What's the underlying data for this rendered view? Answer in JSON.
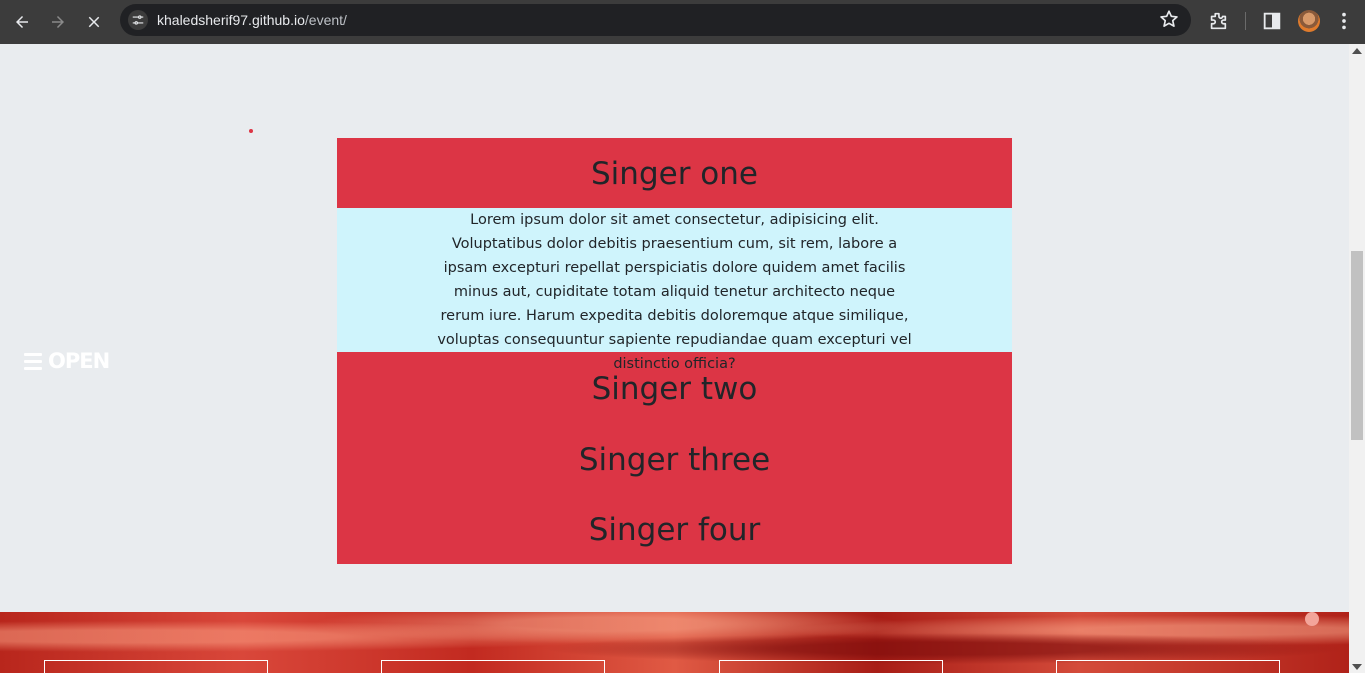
{
  "browser": {
    "url_domain": "khaledsherif97.github.io",
    "url_path": "/event/"
  },
  "sidebar": {
    "open_label": "OPEN"
  },
  "accordion": {
    "items": [
      {
        "title": "Singer one",
        "body": "Lorem ipsum dolor sit amet consectetur, adipisicing elit. Voluptatibus dolor debitis praesentium cum, sit rem, labore a ipsam excepturi repellat perspiciatis dolore quidem amet facilis minus aut, cupiditate totam aliquid tenetur architecto neque rerum iure. Harum expedita debitis doloremque atque similique, voluptas consequuntur sapiente repudiandae quam excepturi vel distinctio officia?"
      },
      {
        "title": "Singer two"
      },
      {
        "title": "Singer three"
      },
      {
        "title": "Singer four"
      }
    ]
  },
  "colors": {
    "accent": "#dc3545",
    "panel": "#cff4fc",
    "page_bg": "#e9ecef",
    "text": "#212529"
  }
}
